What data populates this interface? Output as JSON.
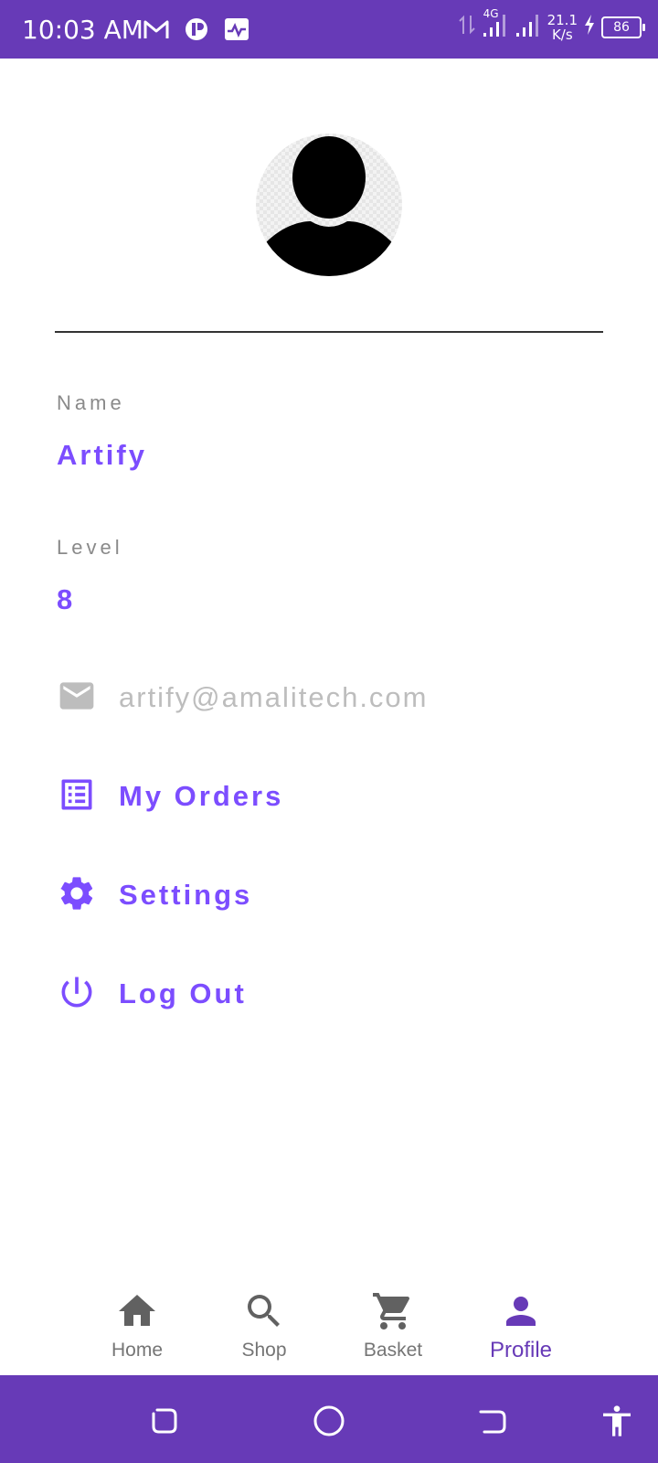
{
  "status_bar": {
    "time": "10:03 AM",
    "network": "4G",
    "net_speed_value": "21.1",
    "net_speed_unit": "K/s",
    "battery": "86",
    "icons": [
      "gmail-icon",
      "app-icon",
      "activity-icon",
      "data-arrows-icon",
      "signal-icon",
      "signal-icon-2",
      "charging-icon",
      "battery-icon"
    ]
  },
  "profile": {
    "name_label": "Name",
    "name_value": "Artify",
    "level_label": "Level",
    "level_value": "8",
    "email": "artify@amalitech.com"
  },
  "menu": {
    "orders_label": "My Orders",
    "settings_label": "Settings",
    "logout_label": "Log Out"
  },
  "bottom_nav": {
    "items": [
      {
        "label": "Home",
        "icon": "home-icon",
        "active": false
      },
      {
        "label": "Shop",
        "icon": "search-icon",
        "active": false
      },
      {
        "label": "Basket",
        "icon": "cart-icon",
        "active": false
      },
      {
        "label": "Profile",
        "icon": "person-icon",
        "active": true
      }
    ]
  },
  "system_nav": {
    "icons": [
      "recents-icon",
      "home-circle-icon",
      "back-icon",
      "accessibility-icon"
    ]
  },
  "colors": {
    "primary": "#673ab7",
    "accent": "#7c4dff",
    "label_gray": "#8a8a8a",
    "email_gray": "#bdbdbd",
    "nav_inactive": "#757575"
  }
}
